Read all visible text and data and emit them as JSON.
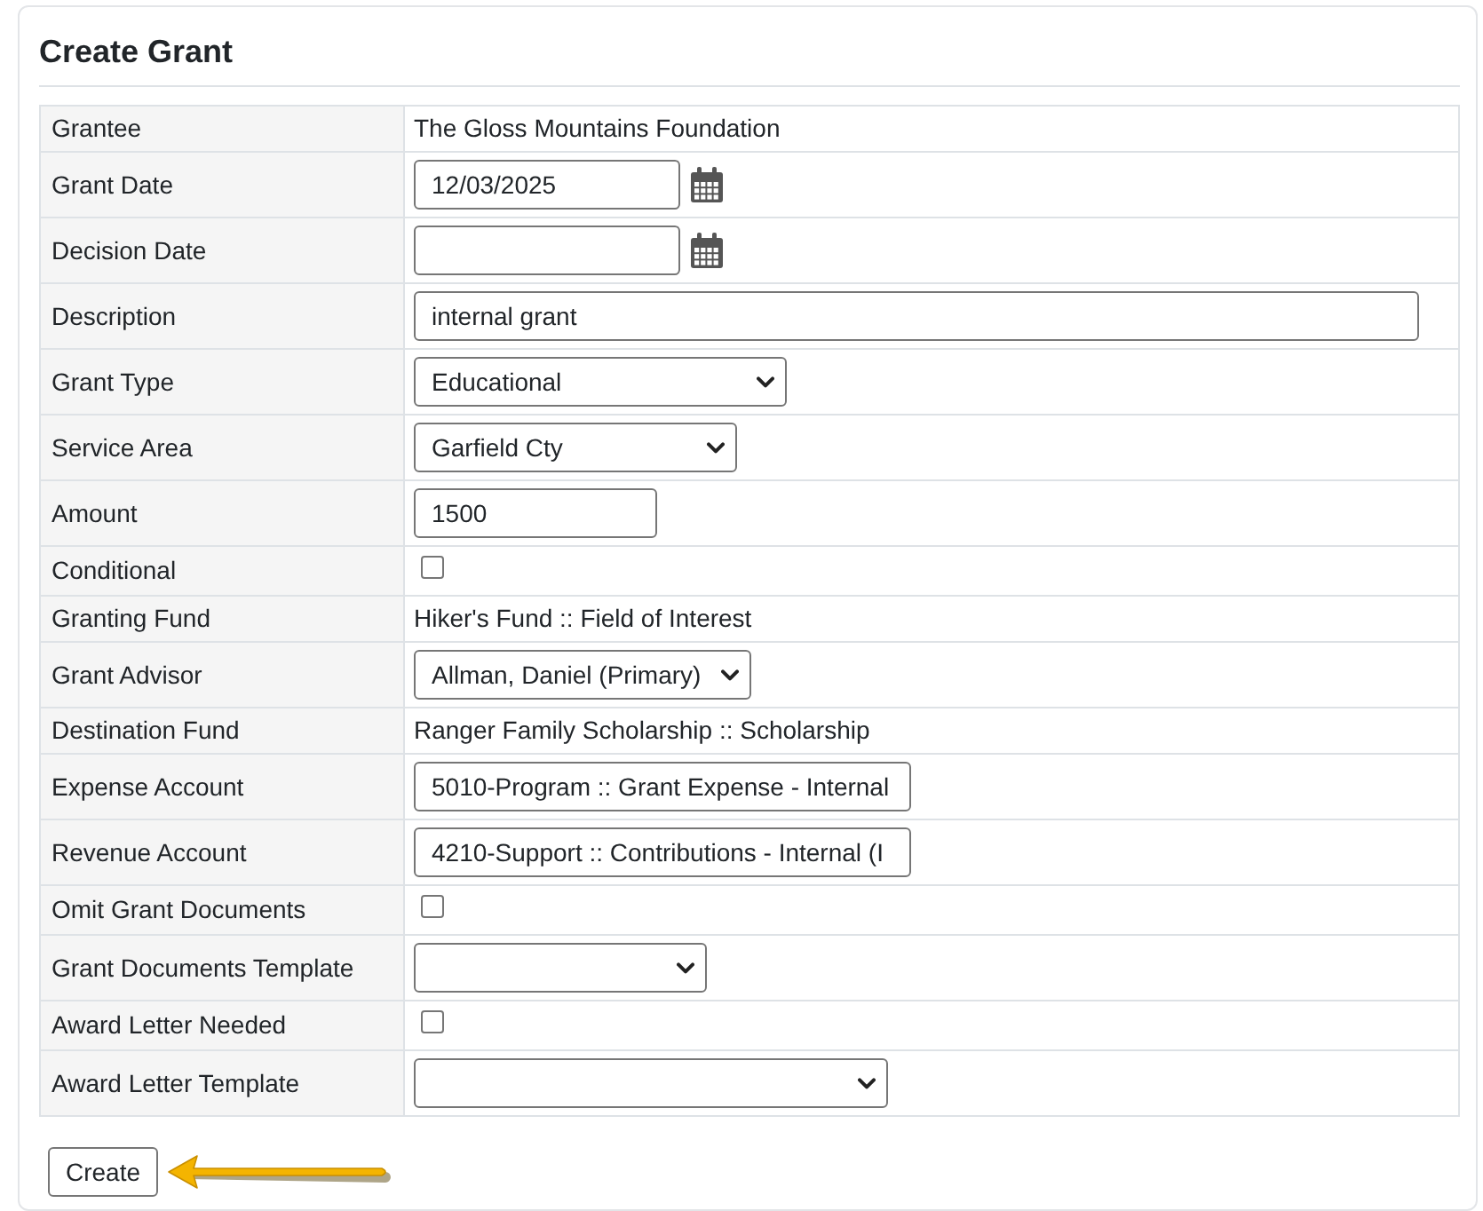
{
  "form": {
    "title": "Create Grant",
    "rows": [
      {
        "label": "Grantee",
        "kind": "text",
        "value": "The Gloss Mountains Foundation"
      },
      {
        "label": "Grant Date",
        "kind": "date",
        "value": "12/03/2025"
      },
      {
        "label": "Decision Date",
        "kind": "date"
      },
      {
        "label": "Description",
        "kind": "input",
        "value": "internal grant"
      },
      {
        "label": "Grant Type",
        "kind": "select",
        "value": "Educational"
      },
      {
        "label": "Service Area",
        "kind": "select",
        "value": "Garfield Cty"
      },
      {
        "label": "Amount",
        "kind": "input",
        "value": "1500"
      },
      {
        "label": "Conditional",
        "kind": "checkbox",
        "checked": false
      },
      {
        "label": "Granting Fund",
        "kind": "text",
        "value": "Hiker's Fund :: Field of Interest"
      },
      {
        "label": "Grant Advisor",
        "kind": "select",
        "value": "Allman, Daniel (Primary)"
      },
      {
        "label": "Destination Fund",
        "kind": "text",
        "value": "Ranger Family Scholarship :: Scholarship"
      },
      {
        "label": "Expense Account",
        "kind": "input",
        "value": "5010-Program :: Grant Expense - Internal"
      },
      {
        "label": "Revenue Account",
        "kind": "input",
        "value": "4210-Support :: Contributions - Internal (I"
      },
      {
        "label": "Omit Grant Documents",
        "kind": "checkbox",
        "checked": false
      },
      {
        "label": "Grant Documents Template",
        "kind": "select"
      },
      {
        "label": "Award Letter Needed",
        "kind": "checkbox",
        "checked": false
      },
      {
        "label": "Award Letter Template",
        "kind": "select"
      }
    ],
    "create_button": {
      "label": "Create"
    }
  }
}
